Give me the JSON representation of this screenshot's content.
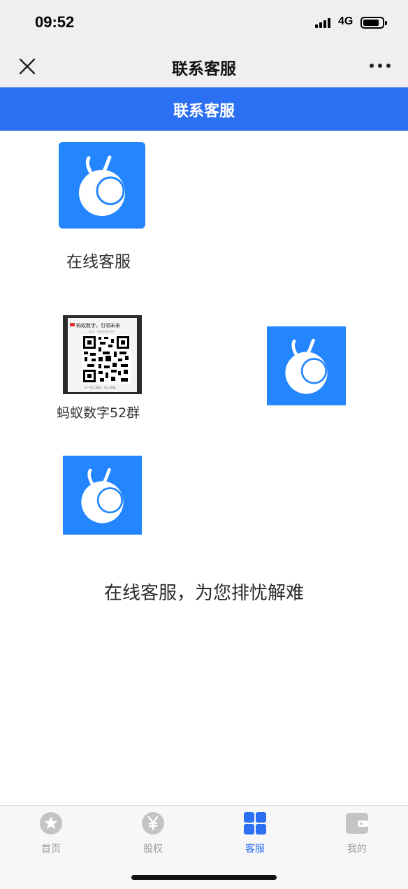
{
  "status_bar": {
    "time": "09:52",
    "network": "4G",
    "icons": [
      "signal-icon",
      "battery-icon"
    ]
  },
  "nav": {
    "title": "联系客服",
    "icons": [
      "close-icon",
      "more-icon"
    ]
  },
  "header": {
    "title": "联系客服"
  },
  "contacts": [
    {
      "label": "在线客服",
      "icon": "app-logo-icon"
    },
    {
      "label": "蚂蚁数字52群",
      "icon": "qr-code-thumbnail"
    },
    {
      "label": "",
      "icon": "app-logo-icon"
    },
    {
      "label": "",
      "icon": "app-logo-icon"
    }
  ],
  "qr_card": {
    "title": "蚂蚁数字，引领未来",
    "subtitle": "群号：4AA34D769",
    "footer": "扫一扫二维码，加入群聊。"
  },
  "tagline": "在线客服，为您排忧解难",
  "tabs": [
    {
      "label": "首页",
      "icon": "star-icon",
      "active": false
    },
    {
      "label": "股权",
      "icon": "yen-icon",
      "active": false
    },
    {
      "label": "客服",
      "icon": "grid-icon",
      "active": true
    },
    {
      "label": "我的",
      "icon": "wallet-icon",
      "active": false
    }
  ],
  "colors": {
    "accent": "#2b6ff2",
    "logo_bg": "#2386ff",
    "bar_bg": "#efefef",
    "tab_inactive": "#9c9c9c"
  }
}
